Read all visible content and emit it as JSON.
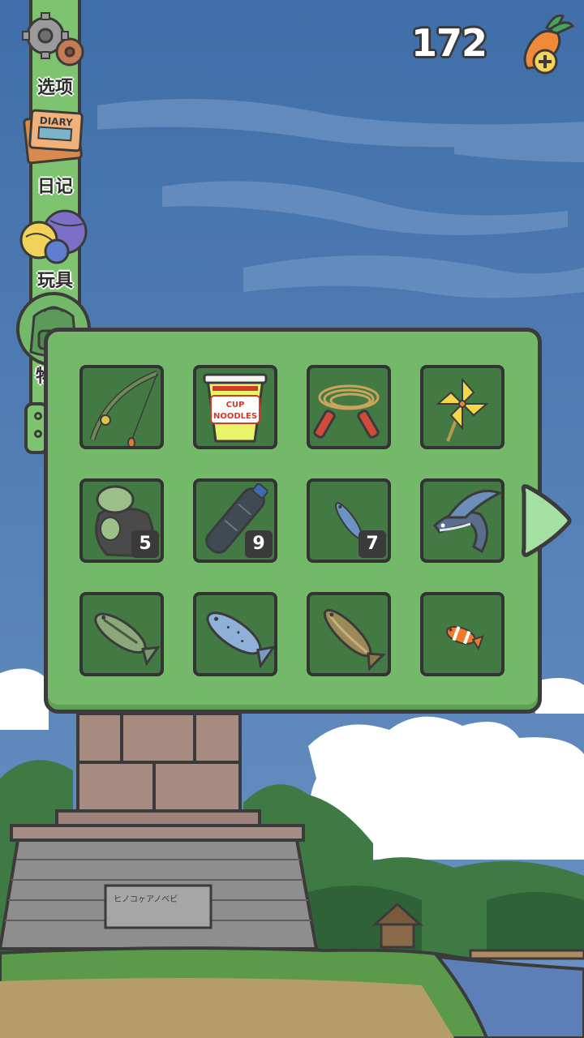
{
  "currency": {
    "carrots": "172",
    "icon": "carrot-plus-icon"
  },
  "sidebar": {
    "items": [
      {
        "label": "选项",
        "icon": "gears-icon"
      },
      {
        "label": "日记",
        "icon": "diary-book-icon"
      },
      {
        "label": "玩具",
        "icon": "yarn-balls-icon"
      },
      {
        "label": "物品",
        "icon": "backpack-icon"
      }
    ]
  },
  "inventory": {
    "items": [
      {
        "name": "fishing-rod",
        "icon": "fishing-rod-icon",
        "count": ""
      },
      {
        "name": "cup-noodles",
        "icon": "cup-noodles-icon",
        "count": "",
        "text": "CUP NOODLES"
      },
      {
        "name": "jump-rope",
        "icon": "jump-rope-icon",
        "count": ""
      },
      {
        "name": "pinwheel",
        "icon": "pinwheel-icon",
        "count": ""
      },
      {
        "name": "trash-bag",
        "icon": "trash-bag-icon",
        "count": "5"
      },
      {
        "name": "plastic-bottle",
        "icon": "plastic-bottle-icon",
        "count": "9"
      },
      {
        "name": "small-fish",
        "icon": "small-fish-icon",
        "count": "7"
      },
      {
        "name": "flying-fish",
        "icon": "flying-fish-icon",
        "count": ""
      },
      {
        "name": "bass",
        "icon": "bass-icon",
        "count": ""
      },
      {
        "name": "salmon",
        "icon": "salmon-icon",
        "count": ""
      },
      {
        "name": "trout",
        "icon": "trout-icon",
        "count": ""
      },
      {
        "name": "clownfish",
        "icon": "clownfish-icon",
        "count": ""
      }
    ]
  },
  "monument": {
    "plaque_text": "ヒノコヶアノベビ"
  },
  "colors": {
    "panel": "#74b869",
    "slot": "#437a43",
    "sky": "#4f79b0",
    "outline": "#3b3b3b"
  }
}
